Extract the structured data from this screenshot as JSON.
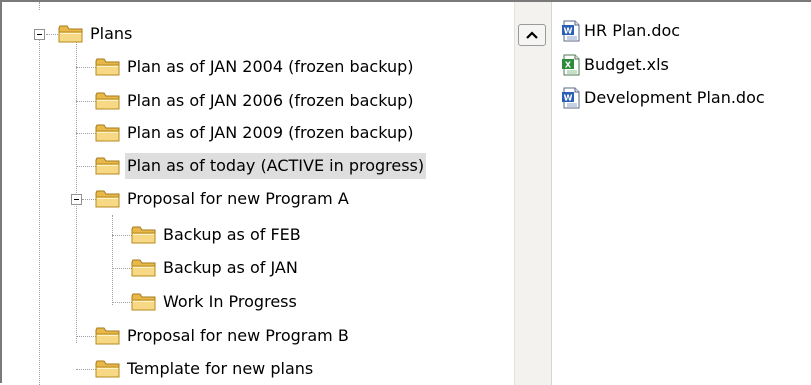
{
  "tree": {
    "root": "Plans",
    "items": [
      {
        "label": "Plan as of JAN 2004 (frozen backup)"
      },
      {
        "label": "Plan as of JAN 2006 (frozen backup)"
      },
      {
        "label": "Plan as of JAN 2009 (frozen backup)"
      },
      {
        "label": "Plan as of today (ACTIVE in progress)",
        "selected": true
      },
      {
        "label": "Proposal for new Program A",
        "expanded": true
      },
      {
        "label": "Backup as of FEB"
      },
      {
        "label": "Backup as of JAN"
      },
      {
        "label": "Work In Progress"
      },
      {
        "label": "Proposal for new Program B"
      },
      {
        "label": "Template for new plans"
      }
    ]
  },
  "files": [
    {
      "label": "HR Plan.doc",
      "icon": "word-doc-icon"
    },
    {
      "label": "Budget.xls",
      "icon": "excel-xls-icon"
    },
    {
      "label": "Development Plan.doc",
      "icon": "word-doc-icon"
    }
  ],
  "colors": {
    "selection": "#dedede",
    "folder": "#f3d27a",
    "word": "#2b5fb4",
    "excel": "#2e8b3a"
  }
}
